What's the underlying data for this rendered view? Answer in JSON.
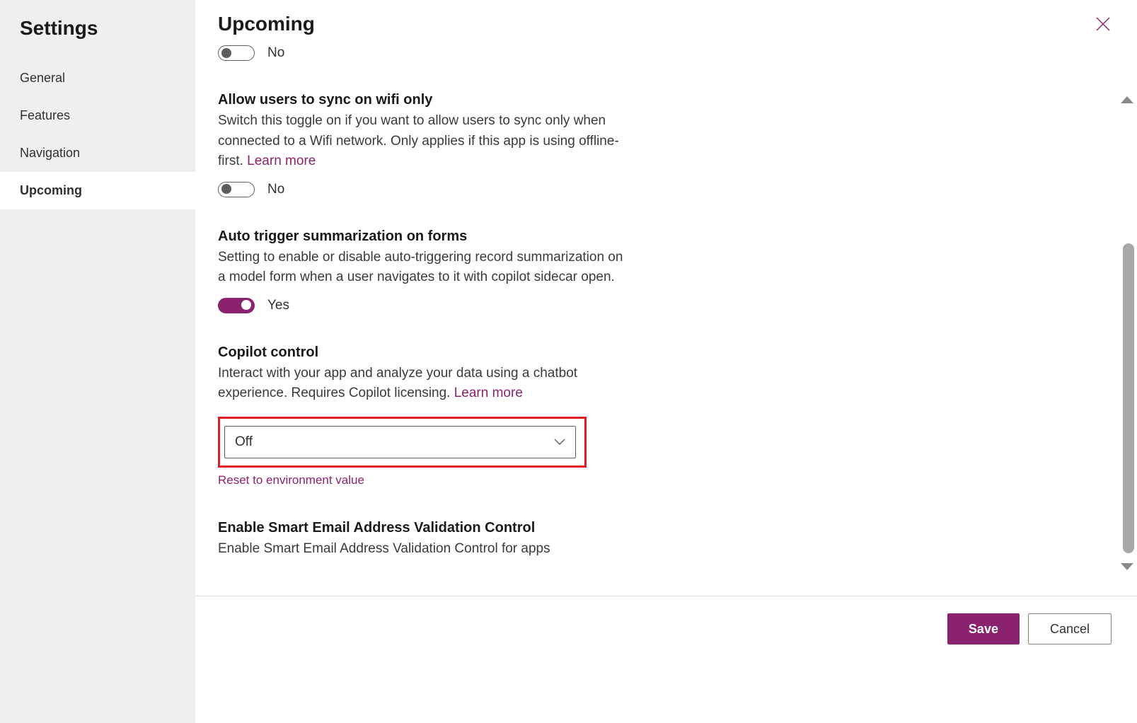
{
  "sidebar": {
    "title": "Settings",
    "items": [
      {
        "label": "General"
      },
      {
        "label": "Features"
      },
      {
        "label": "Navigation"
      },
      {
        "label": "Upcoming"
      }
    ],
    "activeIndex": 3
  },
  "header": {
    "title": "Upcoming"
  },
  "settings": {
    "topToggle": {
      "label": "No",
      "on": false
    },
    "wifiSync": {
      "title": "Allow users to sync on wifi only",
      "desc": "Switch this toggle on if you want to allow users to sync only when connected to a Wifi network. Only applies if this app is using offline-first. ",
      "learnMore": "Learn more",
      "toggleLabel": "No",
      "on": false
    },
    "autoSummarize": {
      "title": "Auto trigger summarization on forms",
      "desc": "Setting to enable or disable auto-triggering record summarization on a model form when a user navigates to it with copilot sidecar open.",
      "toggleLabel": "Yes",
      "on": true
    },
    "copilot": {
      "title": "Copilot control",
      "desc": "Interact with your app and analyze your data using a chatbot experience. Requires Copilot licensing. ",
      "learnMore": "Learn more",
      "selected": "Off",
      "resetLink": "Reset to environment value"
    },
    "smartEmail": {
      "title": "Enable Smart Email Address Validation Control",
      "desc": "Enable Smart Email Address Validation Control for apps"
    }
  },
  "footer": {
    "save": "Save",
    "cancel": "Cancel"
  },
  "colors": {
    "accent": "#8a226f",
    "highlight": "#e31b23"
  }
}
